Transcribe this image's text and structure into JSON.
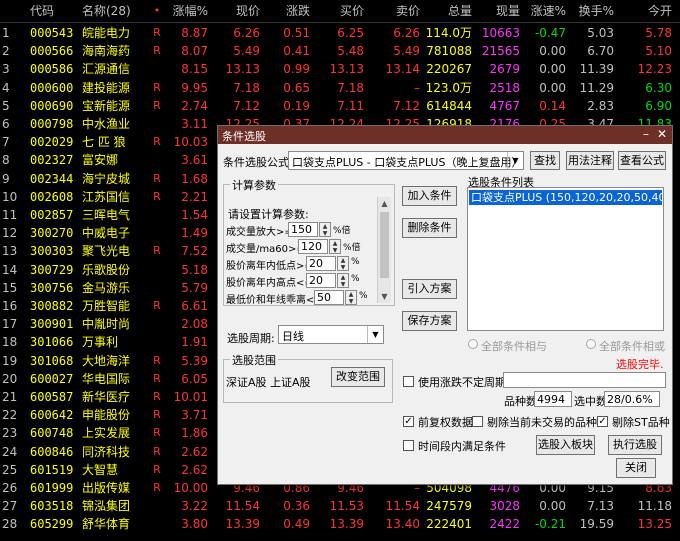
{
  "table": {
    "headers": [
      "",
      "代码",
      "名称(28)",
      "•",
      "涨幅%",
      "现价",
      "涨跌",
      "买价",
      "卖价",
      "总量",
      "现量",
      "涨速%",
      "换手%",
      "今开"
    ],
    "rows": [
      {
        "idx": "1",
        "code": "000543",
        "name": "皖能电力",
        "flag": "R",
        "pct": "8.87",
        "price": "6.26",
        "chg": "0.51",
        "bid": "6.25",
        "ask": "6.26",
        "vol": "114.0万",
        "cur": "10663",
        "spd": "-0.47",
        "turn": "5.03",
        "open": "5.78",
        "pcol": "up",
        "scol": "dn",
        "ocol": "up"
      },
      {
        "idx": "2",
        "code": "000566",
        "name": "海南海药",
        "flag": "R",
        "pct": "8.07",
        "price": "5.49",
        "chg": "0.41",
        "bid": "5.48",
        "ask": "5.49",
        "vol": "781088",
        "cur": "21565",
        "spd": "0.00",
        "turn": "6.70",
        "open": "5.10",
        "pcol": "up",
        "scol": "eq",
        "ocol": "up"
      },
      {
        "idx": "3",
        "code": "000586",
        "name": "汇源通信",
        "flag": "",
        "pct": "8.15",
        "price": "13.13",
        "chg": "0.99",
        "bid": "13.13",
        "ask": "13.14",
        "vol": "220267",
        "cur": "2679",
        "spd": "0.00",
        "turn": "11.39",
        "open": "12.23",
        "pcol": "up",
        "scol": "eq",
        "ocol": "up"
      },
      {
        "idx": "4",
        "code": "000600",
        "name": "建投能源",
        "flag": "R",
        "pct": "9.95",
        "price": "7.18",
        "chg": "0.65",
        "bid": "7.18",
        "ask": "–",
        "vol": "123.0万",
        "cur": "2518",
        "spd": "0.00",
        "turn": "11.29",
        "open": "6.30",
        "pcol": "up",
        "scol": "eq",
        "ocol": "dn"
      },
      {
        "idx": "5",
        "code": "000690",
        "name": "宝新能源",
        "flag": "R",
        "pct": "2.74",
        "price": "7.12",
        "chg": "0.19",
        "bid": "7.11",
        "ask": "7.12",
        "vol": "614844",
        "cur": "4767",
        "spd": "0.14",
        "turn": "2.83",
        "open": "6.90",
        "pcol": "up",
        "scol": "up",
        "ocol": "dn"
      },
      {
        "idx": "6",
        "code": "000798",
        "name": "中水渔业",
        "flag": "",
        "pct": "3.11",
        "price": "12.25",
        "chg": "0.37",
        "bid": "12.24",
        "ask": "12.25",
        "vol": "126918",
        "cur": "2176",
        "spd": "0.25",
        "turn": "3.47",
        "open": "11.83",
        "pcol": "up",
        "scol": "up",
        "ocol": "dn"
      },
      {
        "idx": "7",
        "code": "002029",
        "name": "七 匹 狼",
        "flag": "R",
        "pct": "10.03",
        "price": "",
        "chg": "",
        "bid": "",
        "ask": "",
        "vol": "",
        "cur": "",
        "spd": "",
        "turn": "",
        "open": "",
        "pcol": "up",
        "scol": "eq",
        "ocol": "up"
      },
      {
        "idx": "8",
        "code": "002327",
        "name": "富安娜",
        "flag": "",
        "pct": "3.61",
        "price": "",
        "chg": "",
        "bid": "",
        "ask": "",
        "vol": "",
        "cur": "",
        "spd": "",
        "turn": "",
        "open": "",
        "pcol": "up",
        "scol": "eq",
        "ocol": "up"
      },
      {
        "idx": "9",
        "code": "002344",
        "name": "海宁皮城",
        "flag": "R",
        "pct": "1.68",
        "price": "",
        "chg": "",
        "bid": "",
        "ask": "",
        "vol": "",
        "cur": "",
        "spd": "",
        "turn": "",
        "open": "",
        "pcol": "up",
        "scol": "eq",
        "ocol": "up"
      },
      {
        "idx": "10",
        "code": "002608",
        "name": "江苏国信",
        "flag": "R",
        "pct": "2.21",
        "price": "",
        "chg": "",
        "bid": "",
        "ask": "",
        "vol": "",
        "cur": "",
        "spd": "",
        "turn": "",
        "open": "",
        "pcol": "up",
        "scol": "eq",
        "ocol": "up"
      },
      {
        "idx": "11",
        "code": "002857",
        "name": "三晖电气",
        "flag": "",
        "pct": "1.54",
        "price": "",
        "chg": "",
        "bid": "",
        "ask": "",
        "vol": "",
        "cur": "",
        "spd": "",
        "turn": "",
        "open": "",
        "pcol": "up",
        "scol": "eq",
        "ocol": "up"
      },
      {
        "idx": "12",
        "code": "300270",
        "name": "中威电子",
        "flag": "",
        "pct": "1.49",
        "price": "",
        "chg": "",
        "bid": "",
        "ask": "",
        "vol": "",
        "cur": "",
        "spd": "",
        "turn": "",
        "open": "",
        "pcol": "up",
        "scol": "eq",
        "ocol": "up"
      },
      {
        "idx": "13",
        "code": "300303",
        "name": "聚飞光电",
        "flag": "R",
        "pct": "7.52",
        "price": "",
        "chg": "",
        "bid": "",
        "ask": "",
        "vol": "",
        "cur": "",
        "spd": "",
        "turn": "",
        "open": "",
        "pcol": "up",
        "scol": "eq",
        "ocol": "up"
      },
      {
        "idx": "14",
        "code": "300729",
        "name": "乐歌股份",
        "flag": "",
        "pct": "5.18",
        "price": "",
        "chg": "",
        "bid": "",
        "ask": "",
        "vol": "",
        "cur": "",
        "spd": "",
        "turn": "",
        "open": "",
        "pcol": "up",
        "scol": "eq",
        "ocol": "up"
      },
      {
        "idx": "15",
        "code": "300756",
        "name": "金马游乐",
        "flag": "",
        "pct": "5.79",
        "price": "",
        "chg": "",
        "bid": "",
        "ask": "",
        "vol": "",
        "cur": "",
        "spd": "",
        "turn": "",
        "open": "",
        "pcol": "up",
        "scol": "eq",
        "ocol": "up"
      },
      {
        "idx": "16",
        "code": "300882",
        "name": "万胜智能",
        "flag": "R",
        "pct": "6.61",
        "price": "",
        "chg": "",
        "bid": "",
        "ask": "",
        "vol": "",
        "cur": "",
        "spd": "",
        "turn": "",
        "open": "",
        "pcol": "up",
        "scol": "eq",
        "ocol": "up"
      },
      {
        "idx": "17",
        "code": "300901",
        "name": "中胤时尚",
        "flag": "",
        "pct": "2.08",
        "price": "",
        "chg": "",
        "bid": "",
        "ask": "",
        "vol": "",
        "cur": "",
        "spd": "",
        "turn": "",
        "open": "",
        "pcol": "up",
        "scol": "eq",
        "ocol": "up"
      },
      {
        "idx": "18",
        "code": "301066",
        "name": "万事利",
        "flag": "",
        "pct": "1.91",
        "price": "",
        "chg": "",
        "bid": "",
        "ask": "",
        "vol": "",
        "cur": "",
        "spd": "",
        "turn": "",
        "open": "",
        "pcol": "up",
        "scol": "eq",
        "ocol": "up"
      },
      {
        "idx": "19",
        "code": "301068",
        "name": "大地海洋",
        "flag": "R",
        "pct": "5.39",
        "price": "",
        "chg": "",
        "bid": "",
        "ask": "",
        "vol": "",
        "cur": "",
        "spd": "",
        "turn": "",
        "open": "",
        "pcol": "up",
        "scol": "eq",
        "ocol": "up"
      },
      {
        "idx": "20",
        "code": "600027",
        "name": "华电国际",
        "flag": "R",
        "pct": "6.05",
        "price": "",
        "chg": "",
        "bid": "",
        "ask": "",
        "vol": "",
        "cur": "",
        "spd": "",
        "turn": "",
        "open": "",
        "pcol": "up",
        "scol": "eq",
        "ocol": "up"
      },
      {
        "idx": "21",
        "code": "600587",
        "name": "新华医疗",
        "flag": "R",
        "pct": "10.01",
        "price": "",
        "chg": "",
        "bid": "",
        "ask": "",
        "vol": "",
        "cur": "",
        "spd": "",
        "turn": "",
        "open": "",
        "pcol": "up",
        "scol": "eq",
        "ocol": "up"
      },
      {
        "idx": "22",
        "code": "600642",
        "name": "申能股份",
        "flag": "R",
        "pct": "3.71",
        "price": "",
        "chg": "",
        "bid": "",
        "ask": "",
        "vol": "",
        "cur": "",
        "spd": "",
        "turn": "",
        "open": "",
        "pcol": "up",
        "scol": "eq",
        "ocol": "up"
      },
      {
        "idx": "23",
        "code": "600748",
        "name": "上实发展",
        "flag": "R",
        "pct": "1.86",
        "price": "",
        "chg": "",
        "bid": "",
        "ask": "",
        "vol": "",
        "cur": "",
        "spd": "",
        "turn": "",
        "open": "",
        "pcol": "up",
        "scol": "eq",
        "ocol": "up"
      },
      {
        "idx": "24",
        "code": "600846",
        "name": "同济科技",
        "flag": "R",
        "pct": "2.62",
        "price": "",
        "chg": "",
        "bid": "",
        "ask": "",
        "vol": "",
        "cur": "",
        "spd": "",
        "turn": "",
        "open": "",
        "pcol": "up",
        "scol": "eq",
        "ocol": "up"
      },
      {
        "idx": "25",
        "code": "601519",
        "name": "大智慧",
        "flag": "R",
        "pct": "2.62",
        "price": "",
        "chg": "",
        "bid": "",
        "ask": "",
        "vol": "",
        "cur": "",
        "spd": "",
        "turn": "",
        "open": "",
        "pcol": "up",
        "scol": "eq",
        "ocol": "up"
      },
      {
        "idx": "26",
        "code": "601999",
        "name": "出版传媒",
        "flag": "R",
        "pct": "10.00",
        "price": "9.46",
        "chg": "0.86",
        "bid": "9.46",
        "ask": "–",
        "vol": "504098",
        "cur": "4476",
        "spd": "0.00",
        "turn": "9.15",
        "open": "8.63",
        "pcol": "up",
        "scol": "eq",
        "ocol": "up"
      },
      {
        "idx": "27",
        "code": "603518",
        "name": "锦泓集团",
        "flag": "",
        "pct": "3.22",
        "price": "11.54",
        "chg": "0.36",
        "bid": "11.53",
        "ask": "11.54",
        "vol": "247579",
        "cur": "3028",
        "spd": "0.00",
        "turn": "7.13",
        "open": "11.18",
        "pcol": "up",
        "scol": "eq",
        "ocol": "eq"
      },
      {
        "idx": "28",
        "code": "605299",
        "name": "舒华体育",
        "flag": "",
        "pct": "3.80",
        "price": "13.39",
        "chg": "0.49",
        "bid": "13.39",
        "ask": "13.40",
        "vol": "222401",
        "cur": "2422",
        "spd": "-0.21",
        "turn": "19.59",
        "open": "13.25",
        "pcol": "up",
        "scol": "dn",
        "ocol": "up"
      }
    ]
  },
  "dialog": {
    "title": "条件选股",
    "formula_label": "条件选股公式",
    "formula_value": "口袋支点PLUS - 口袋支点PLUS（晚上复盘用）",
    "find_btn": "查找",
    "usage_btn": "用法注释",
    "view_formula_btn": "查看公式",
    "params_caption": "计算参数",
    "params_prompt": "请设置计算参数:",
    "params": [
      {
        "label": "成交量放大>=",
        "value": "150",
        "unit": "%倍"
      },
      {
        "label": "成交量/ma60>=",
        "value": "120",
        "unit": "%倍"
      },
      {
        "label": "股价离年内低点>=",
        "value": "20",
        "unit": "%"
      },
      {
        "label": "股价离年内高点<=",
        "value": "20",
        "unit": "%"
      },
      {
        "label": "最低价和年线乖离<=",
        "value": "50",
        "unit": "%"
      }
    ],
    "period_label": "选股周期:",
    "period_value": "日线",
    "add_condition_btn": "加入条件",
    "delete_condition_btn": "删除条件",
    "load_plan_btn": "引入方案",
    "save_plan_btn": "保存方案",
    "list_caption": "选股条件列表",
    "list_items": [
      "口袋支点PLUS (150,120,20,20,50,40,1"
    ],
    "and_label": "全部条件相与",
    "or_label": "全部条件相或",
    "done_text": "选股完毕.",
    "range_caption": "选股范围",
    "range_value": "深证A股 上证A股",
    "change_range_btn": "改变范围",
    "use_period_label": "使用涨跌不定周期",
    "total_label": "品种数",
    "total_value": "4994",
    "selected_label": "选中数",
    "selected_value": "28/0.6%",
    "prior_label": "前复权数据",
    "remove_untraded_label": "剔除当前未交易的品种",
    "remove_st_label": "剔除ST品种",
    "time_cond_label": "时间段内满足条件",
    "add_to_board_btn": "选股入板块",
    "execute_btn": "执行选股",
    "close_btn": "关闭",
    "colors": {
      "title_bg": "#6e2f27",
      "list_sel": "#0a64d8",
      "done": "#ff0000"
    }
  }
}
